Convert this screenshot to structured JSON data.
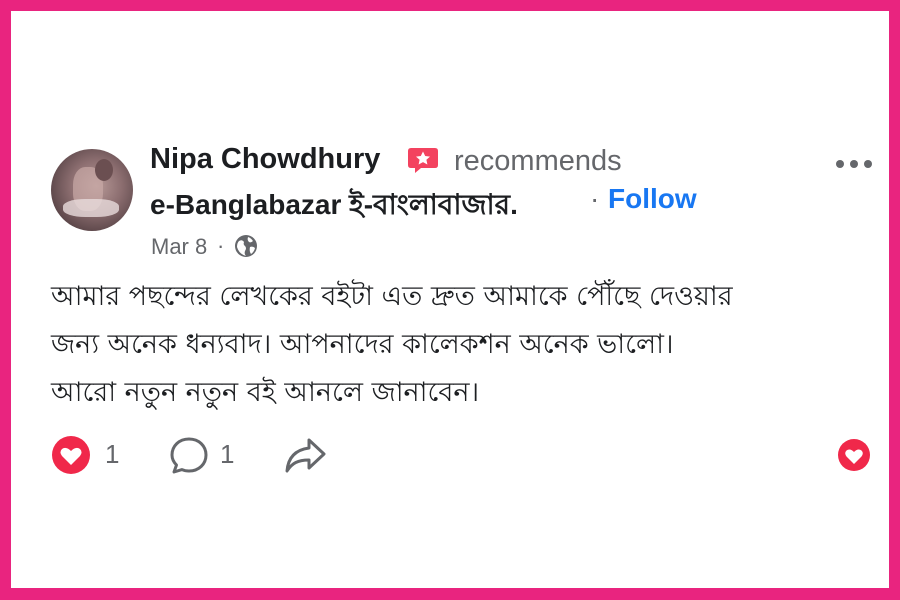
{
  "post": {
    "author": "Nipa Chowdhury",
    "action": "recommends",
    "page": "e-Banglabazar ই-বাংলাবাজার.",
    "separator": "·",
    "follow_label": "Follow",
    "date": "Mar 8",
    "date_separator": "·",
    "audience_icon": "globe-icon",
    "body_lines": [
      "আমার পছন্দের লেখকের বইটা এত দ্রুত আমাকে পৌঁছে দেওয়ার",
      "জন্য অনেক ধন্যবাদ। আপনাদের কালেকশন অনেক ভালো।",
      "আরো নতুন নতুন বই আনলে জানাবেন।"
    ]
  },
  "actions": {
    "reaction_count": "1",
    "comment_count": "1"
  },
  "colors": {
    "frame": "#e9247f",
    "accent": "#1877f2",
    "heart": "#f0284a",
    "recommend_badge": "#f3425f",
    "secondary_text": "#65676b"
  }
}
